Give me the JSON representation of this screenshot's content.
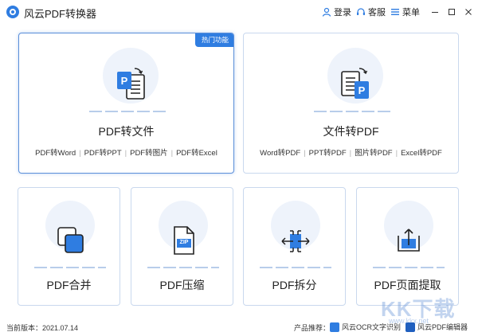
{
  "app": {
    "title": "风云PDF转换器"
  },
  "toolbar": {
    "login": "登录",
    "service": "客服",
    "menu": "菜单"
  },
  "cards": {
    "pdf_to_file": {
      "title": "PDF转文件",
      "badge": "热门功能",
      "links": [
        "PDF转Word",
        "PDF转PPT",
        "PDF转图片",
        "PDF转Excel"
      ]
    },
    "file_to_pdf": {
      "title": "文件转PDF",
      "links": [
        "Word转PDF",
        "PPT转PDF",
        "图片转PDF",
        "Excel转PDF"
      ]
    },
    "merge": {
      "title": "PDF合并"
    },
    "compress": {
      "title": "PDF压缩",
      "icon_text": "ZIP"
    },
    "split": {
      "title": "PDF拆分"
    },
    "extract": {
      "title": "PDF页面提取"
    }
  },
  "status": {
    "version": "当前版本：2021.07.14",
    "promo_label": "产品推荐：",
    "promo_items": [
      "风云OCR文字识别",
      "风云PDF编辑器"
    ]
  },
  "watermark": {
    "main": "KK下载",
    "sub": "www.kkx.net"
  },
  "colors": {
    "accent": "#2f7de1",
    "card_border": "#c9d8ee"
  }
}
